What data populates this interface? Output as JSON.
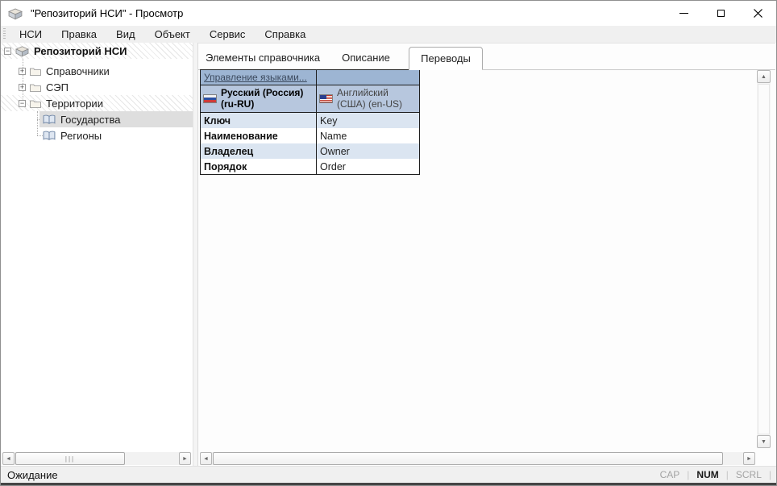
{
  "window": {
    "title": "\"Репозиторий НСИ\" - Просмотр"
  },
  "menu": {
    "items": [
      "НСИ",
      "Правка",
      "Вид",
      "Объект",
      "Сервис",
      "Справка"
    ]
  },
  "tree": {
    "root_label": "Репозиторий НСИ",
    "items": [
      {
        "label": "Справочники"
      },
      {
        "label": "СЭП"
      },
      {
        "label": "Территории"
      },
      {
        "label": "Государства"
      },
      {
        "label": "Регионы"
      }
    ],
    "selected": "Государства"
  },
  "tabs": {
    "items": [
      "Элементы справочника",
      "Описание",
      "Переводы"
    ],
    "active": "Переводы"
  },
  "translations": {
    "manage_languages_link": "Управление языками...",
    "languages": [
      {
        "name": "Русский (Россия) (ru-RU)",
        "flag": "flag-ru-icon"
      },
      {
        "name": "Английский (США) (en-US)",
        "flag": "flag-us-icon"
      }
    ],
    "rows": [
      {
        "key": "Ключ",
        "value": "Key"
      },
      {
        "key": "Наименование",
        "value": "Name"
      },
      {
        "key": "Владелец",
        "value": "Owner"
      },
      {
        "key": "Порядок",
        "value": "Order"
      }
    ]
  },
  "statusbar": {
    "message": "Ожидание",
    "keys": [
      "CAP",
      "NUM",
      "SCRL"
    ]
  },
  "icons": {
    "collapse": "−",
    "expand": "+",
    "scroll_up": "▲",
    "scroll_down": "▼",
    "scroll_left": "◄",
    "scroll_right": "►",
    "grip": "|||"
  },
  "colors": {
    "table_header": "#9db5d3",
    "table_subheader": "#b7c7de",
    "table_row_alt": "#dbe5f1",
    "menubar_bg": "#f0f0f0",
    "selection_bg": "#dedede",
    "link_text": "#3c4a5e"
  }
}
